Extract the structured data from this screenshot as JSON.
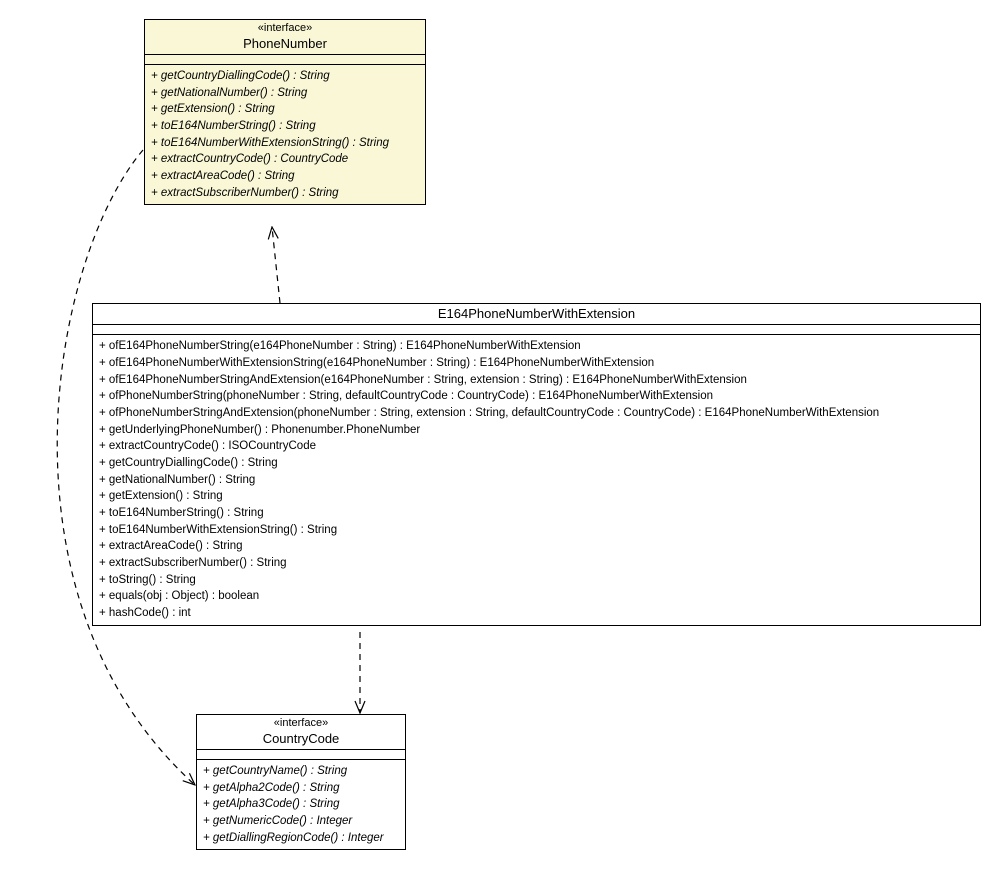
{
  "classes": {
    "phoneNumber": {
      "stereotype": "«interface»",
      "name": "PhoneNumber",
      "ops": [
        "+ getCountryDiallingCode() : String",
        "+ getNationalNumber() : String",
        "+ getExtension() : String",
        "+ toE164NumberString() : String",
        "+ toE164NumberWithExtensionString() : String",
        "+ extractCountryCode() : CountryCode",
        "+ extractAreaCode() : String",
        "+ extractSubscriberNumber() : String"
      ]
    },
    "e164": {
      "name": "E164PhoneNumberWithExtension",
      "ops": [
        "+ ofE164PhoneNumberString(e164PhoneNumber : String) : E164PhoneNumberWithExtension",
        "+ ofE164PhoneNumberWithExtensionString(e164PhoneNumber : String) : E164PhoneNumberWithExtension",
        "+ ofE164PhoneNumberStringAndExtension(e164PhoneNumber : String, extension : String) : E164PhoneNumberWithExtension",
        "+ ofPhoneNumberString(phoneNumber : String, defaultCountryCode : CountryCode) : E164PhoneNumberWithExtension",
        "+ ofPhoneNumberStringAndExtension(phoneNumber : String, extension : String, defaultCountryCode : CountryCode) : E164PhoneNumberWithExtension",
        "+ getUnderlyingPhoneNumber() : Phonenumber.PhoneNumber",
        "+ extractCountryCode() : ISOCountryCode",
        "+ getCountryDiallingCode() : String",
        "+ getNationalNumber() : String",
        "+ getExtension() : String",
        "+ toE164NumberString() : String",
        "+ toE164NumberWithExtensionString() : String",
        "+ extractAreaCode() : String",
        "+ extractSubscriberNumber() : String",
        "+ toString() : String",
        "+ equals(obj : Object) : boolean",
        "+ hashCode() : int"
      ]
    },
    "countryCode": {
      "stereotype": "«interface»",
      "name": "CountryCode",
      "ops": [
        "+ getCountryName() : String",
        "+ getAlpha2Code() : String",
        "+ getAlpha3Code() : String",
        "+ getNumericCode() : Integer",
        "+ getDiallingRegionCode() : Integer"
      ]
    }
  }
}
